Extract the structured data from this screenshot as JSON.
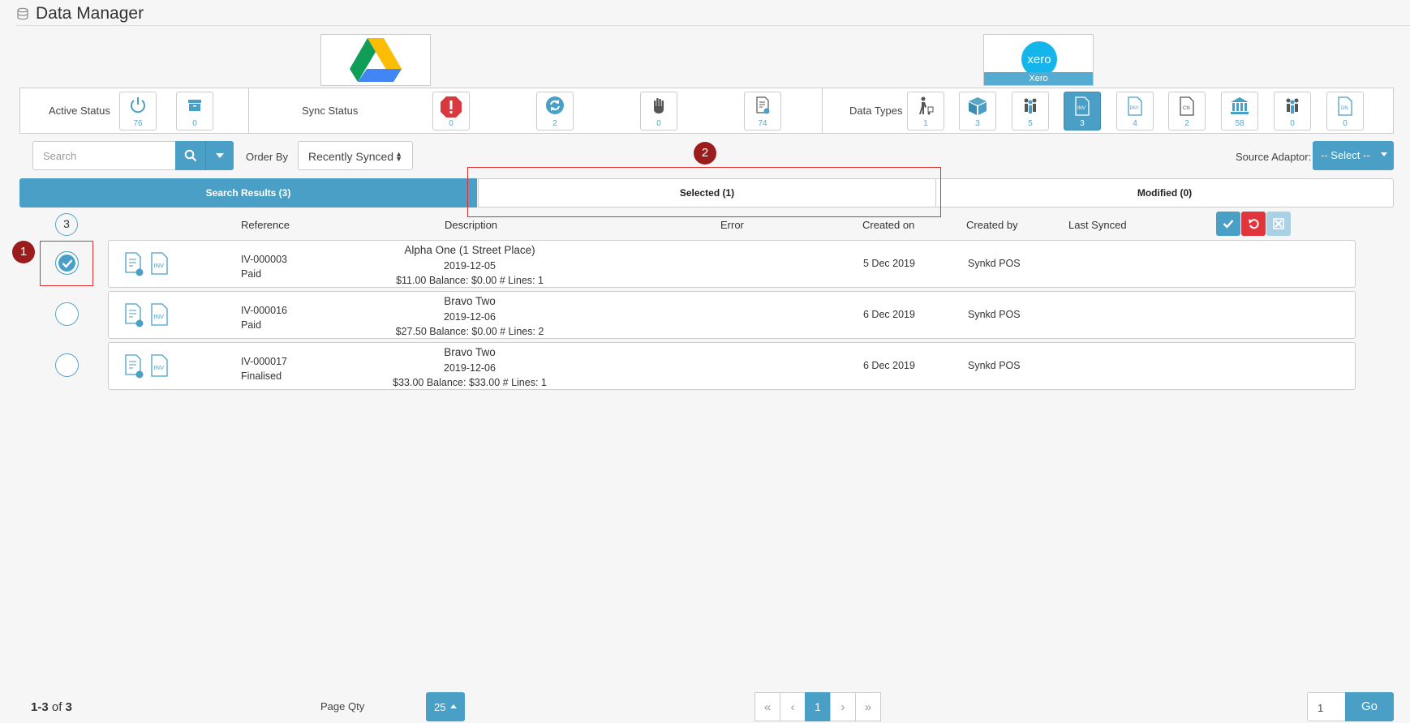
{
  "header": {
    "title": "Data Manager",
    "icon": "database-icon"
  },
  "connectors": {
    "destination_label": "Xero"
  },
  "filters": {
    "active_status": {
      "label": "Active Status",
      "tiles": [
        {
          "icon": "power-icon",
          "count": "76"
        },
        {
          "icon": "archive-icon",
          "count": "0"
        }
      ]
    },
    "sync_status": {
      "label": "Sync Status",
      "tiles": [
        {
          "icon": "error-icon",
          "count": "0"
        },
        {
          "icon": "refresh-icon",
          "count": "2"
        },
        {
          "icon": "hand-stop-icon",
          "count": "0"
        },
        {
          "icon": "document-synced-icon",
          "count": "74"
        }
      ]
    },
    "data_types": {
      "label": "Data Types",
      "tiles": [
        {
          "icon": "delivery-person-icon",
          "count": "1"
        },
        {
          "icon": "box-icon",
          "count": "3"
        },
        {
          "icon": "customers-icon",
          "count": "5"
        },
        {
          "icon": "invoice-icon",
          "count": "3",
          "active": true
        },
        {
          "icon": "payment-icon",
          "count": "4"
        },
        {
          "icon": "credit-note-icon",
          "count": "2"
        },
        {
          "icon": "bank-icon",
          "count": "58"
        },
        {
          "icon": "suppliers-icon",
          "count": "0"
        },
        {
          "icon": "debit-note-icon",
          "count": "0"
        }
      ]
    }
  },
  "search": {
    "placeholder": "Search"
  },
  "order_by": {
    "label": "Order By",
    "value": "Recently Synced"
  },
  "source_adaptor": {
    "label": "Source Adaptor:",
    "value": "-- Select --"
  },
  "tabs": [
    {
      "label": "Search Results (3)",
      "active": true
    },
    {
      "label": "Selected (1)"
    },
    {
      "label": "Modified (0)"
    }
  ],
  "columns": {
    "count": "3",
    "reference": "Reference",
    "description": "Description",
    "error": "Error",
    "created_on": "Created on",
    "created_by": "Created by",
    "last_synced": "Last Synced"
  },
  "rows": [
    {
      "checked": true,
      "ref": "IV-000003",
      "status": "Paid",
      "desc_name": "Alpha One (1 Street Place)",
      "desc_date": "2019-12-05",
      "desc_amounts": "$11.00 Balance: $0.00 # Lines: 1",
      "created_on": "5 Dec 2019",
      "created_by": "Synkd POS"
    },
    {
      "checked": false,
      "ref": "IV-000016",
      "status": "Paid",
      "desc_name": "Bravo Two",
      "desc_date": "2019-12-06",
      "desc_amounts": "$27.50 Balance: $0.00 # Lines: 2",
      "created_on": "6 Dec 2019",
      "created_by": "Synkd POS"
    },
    {
      "checked": false,
      "ref": "IV-000017",
      "status": "Finalised",
      "desc_name": "Bravo Two",
      "desc_date": "2019-12-06",
      "desc_amounts": "$33.00 Balance: $33.00 # Lines: 1",
      "created_on": "6 Dec 2019",
      "created_by": "Synkd POS"
    }
  ],
  "annotations": {
    "one": "1",
    "two": "2"
  },
  "footer": {
    "range": "1-3",
    "of_label": "of",
    "total": "3",
    "page_qty_label": "Page Qty",
    "page_qty_value": "25",
    "current_page": "1",
    "goto_value": "1",
    "go_label": "Go"
  },
  "colors": {
    "accent": "#4a9fc6",
    "danger": "#e0353c",
    "annotation": "#9b1c1c"
  }
}
